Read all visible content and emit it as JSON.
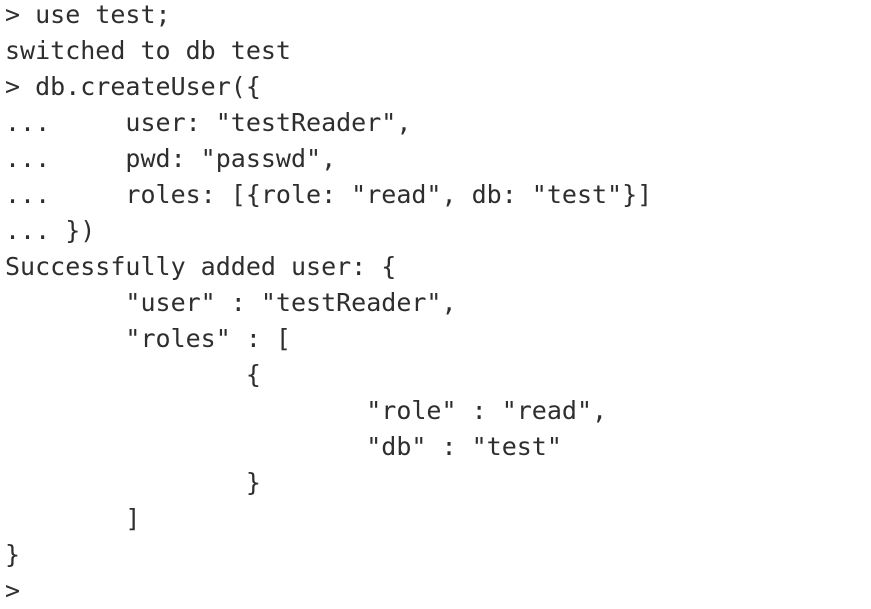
{
  "terminal": {
    "lines": [
      "> use test;",
      "switched to db test",
      "> db.createUser({",
      "...     user: \"testReader\",",
      "...     pwd: \"passwd\",",
      "...     roles: [{role: \"read\", db: \"test\"}]",
      "... })",
      "Successfully added user: {",
      "        \"user\" : \"testReader\",",
      "        \"roles\" : [",
      "                {",
      "                        \"role\" : \"read\",",
      "                        \"db\" : \"test\"",
      "                }",
      "        ]",
      "}",
      "> "
    ]
  }
}
